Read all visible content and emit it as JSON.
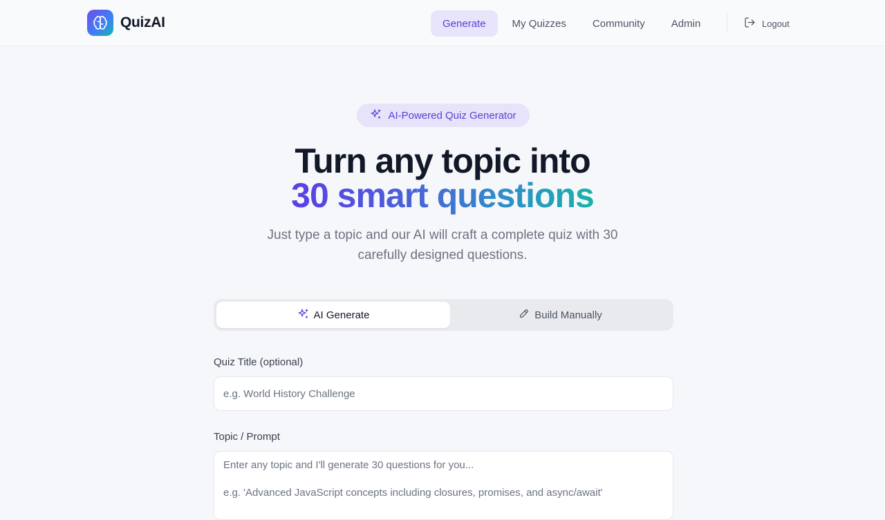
{
  "brand": {
    "name": "QuizAI",
    "icon": "brain-icon"
  },
  "nav": {
    "items": [
      {
        "label": "Generate",
        "active": true
      },
      {
        "label": "My Quizzes",
        "active": false
      },
      {
        "label": "Community",
        "active": false
      },
      {
        "label": "Admin",
        "active": false
      }
    ],
    "logout_label": "Logout",
    "logout_icon": "logout-icon"
  },
  "hero": {
    "badge": "AI-Powered Quiz Generator",
    "badge_icon": "sparkles-icon",
    "title_line1": "Turn any topic into",
    "title_line2": "30 smart questions",
    "subtitle": "Just type a topic and our AI will craft a complete quiz with 30 carefully designed questions."
  },
  "mode_tabs": [
    {
      "label": "AI Generate",
      "icon": "sparkles-icon",
      "active": true
    },
    {
      "label": "Build Manually",
      "icon": "pencil-icon",
      "active": false
    }
  ],
  "form": {
    "title_label": "Quiz Title (optional)",
    "title_placeholder": "e.g. World History Challenge",
    "topic_label": "Topic / Prompt",
    "topic_placeholder": "Enter any topic and I'll generate 30 questions for you...\n\ne.g. 'Advanced JavaScript concepts including closures, promises, and async/await'"
  },
  "colors": {
    "accent": "#5b3fd6",
    "accent_bg": "#e7e4fb",
    "gradient_start": "#5b3fe6",
    "gradient_end": "#18b3a6"
  }
}
